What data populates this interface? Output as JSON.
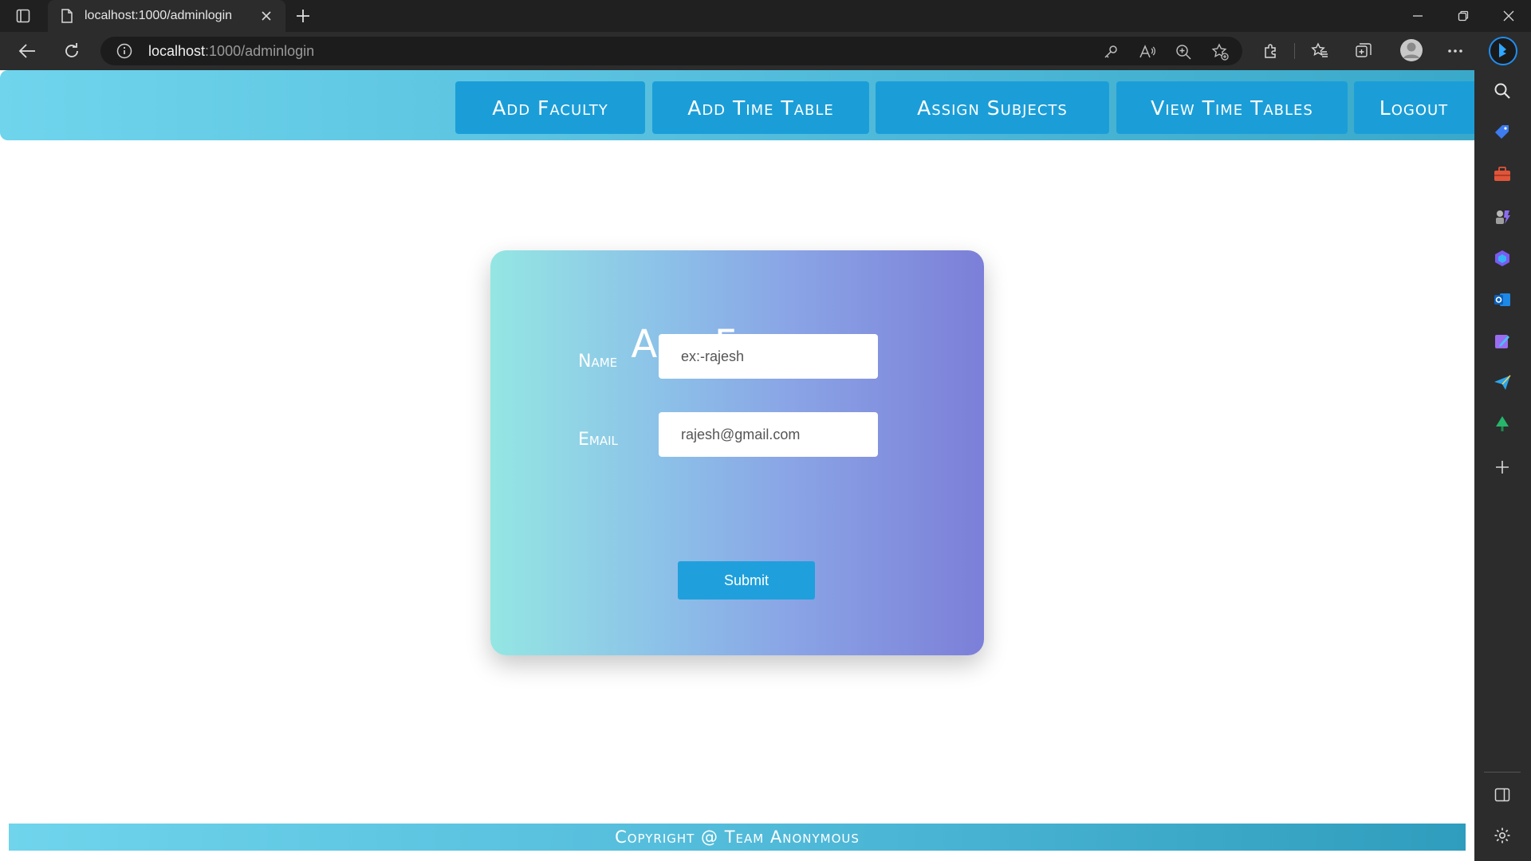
{
  "browser": {
    "tab_title": "localhost:1000/adminlogin",
    "url_host": "localhost",
    "url_path": ":1000/adminlogin"
  },
  "nav": {
    "items": [
      {
        "label": "Add Faculty"
      },
      {
        "label": "Add Time Table"
      },
      {
        "label": "Assign Subjects"
      },
      {
        "label": "View Time Tables"
      },
      {
        "label": "Logout"
      }
    ]
  },
  "form": {
    "title": "Add Faculty",
    "name_label": "Name",
    "name_placeholder": "ex:-rajesh",
    "email_label": "Email",
    "email_placeholder": "rajesh@gmail.com",
    "submit_label": "Submit"
  },
  "footer": {
    "text": "Copyright @ Team Anonymous"
  },
  "colors": {
    "header_gradient_start": "#6fd4ec",
    "nav_button": "#1b9ed8",
    "card_gradient_start": "#94e6e3",
    "card_gradient_end": "#7c7fd8",
    "submit_button": "#1fa0dc"
  }
}
